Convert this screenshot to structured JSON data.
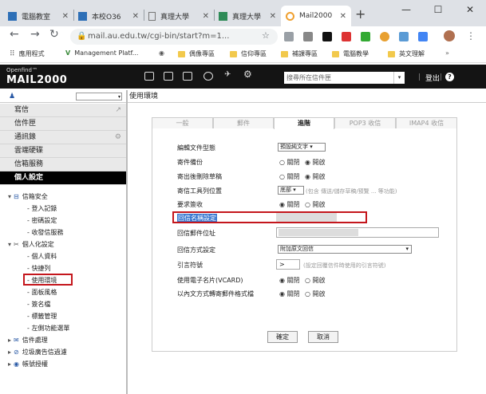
{
  "browser": {
    "tabs": [
      {
        "title": "電腦教室",
        "fav": "#2d6fb7"
      },
      {
        "title": "本校O36",
        "fav": "#2d6fb7"
      },
      {
        "title": "真理大學",
        "fav": "#777777"
      },
      {
        "title": "真理大學",
        "fav": "#2e8b57"
      },
      {
        "title": "Mail2000",
        "fav": "#f0a030"
      }
    ],
    "url": "mail.au.edu.tw/cgi-bin/start?m=1...",
    "bookmarks": [
      {
        "label": "應用程式"
      },
      {
        "label": "Management Platf..."
      },
      {
        "label": "偶像專區"
      },
      {
        "label": "信仰專區"
      },
      {
        "label": "補課專區"
      },
      {
        "label": "電腦教學"
      },
      {
        "label": "英文理解"
      }
    ]
  },
  "app": {
    "logo_top": "Openfind™",
    "logo": "MAIL2000",
    "search_placeholder": "搜尋所在信件匣",
    "logout": "登出",
    "help": "?"
  },
  "sidebar": {
    "nav": [
      {
        "label": "寫信"
      },
      {
        "label": "信件匣"
      },
      {
        "label": "通訊錄"
      },
      {
        "label": "雲端硬碟"
      },
      {
        "label": "信箱服務"
      },
      {
        "label": "個人設定"
      }
    ],
    "tree": [
      {
        "label": "信箱安全",
        "level": 0,
        "mark": "⊟"
      },
      {
        "label": "登入記錄",
        "level": 1
      },
      {
        "label": "密碼設定",
        "level": 1
      },
      {
        "label": "收發信服務",
        "level": 1
      },
      {
        "label": "個人化設定",
        "level": 0,
        "mark": "▾"
      },
      {
        "label": "個人資料",
        "level": 1
      },
      {
        "label": "快捷列",
        "level": 1
      },
      {
        "label": "使用環境",
        "level": 1
      },
      {
        "label": "面板風格",
        "level": 1
      },
      {
        "label": "簽名檔",
        "level": 1
      },
      {
        "label": "標籤管理",
        "level": 1
      },
      {
        "label": "左側功能選單",
        "level": 1
      },
      {
        "label": "信件處理",
        "level": 0,
        "mark": "▸"
      },
      {
        "label": "垃圾廣告信過濾",
        "level": 0,
        "mark": "▸"
      },
      {
        "label": "帳號授權",
        "level": 0,
        "mark": "▸"
      }
    ]
  },
  "main": {
    "title": "使用環境",
    "tabs": [
      {
        "label": "一般"
      },
      {
        "label": "郵件"
      },
      {
        "label": "進階"
      },
      {
        "label": "POP3 收信"
      },
      {
        "label": "IMAP4 收信"
      }
    ],
    "fields": {
      "editor": {
        "label": "編輯文件型態",
        "value": "預設純文字"
      },
      "save_copy": {
        "label": "寄件備份",
        "off": "關閉",
        "on": "開啟"
      },
      "delete_draft": {
        "label": "寄出後刪除草稿",
        "off": "關閉",
        "on": "開啟"
      },
      "toolbar_pos": {
        "label": "寄信工具列位置",
        "value": "底部",
        "note": "(包含 傳送/儲存草稿/預覽 ... 等功能)"
      },
      "receipt": {
        "label": "要求簽收",
        "off": "關閉",
        "on": "開啟"
      },
      "reply_name": {
        "label": "回信名稱設定"
      },
      "reply_addr": {
        "label": "回信郵件位址"
      },
      "reply_mode": {
        "label": "回信方式設定",
        "value": "附加原文回信"
      },
      "quote": {
        "label": "引言符號",
        "value": ">",
        "note": "(設定回覆信件時使用的引言符號)"
      },
      "vcard": {
        "label": "使用電子名片(VCARD)",
        "off": "關閉",
        "on": "開啟"
      },
      "inline_attach": {
        "label": "以內文方式轉寄郵件格式檔",
        "off": "關閉",
        "on": "開啟"
      }
    },
    "ok": "確定",
    "cancel": "取消"
  }
}
